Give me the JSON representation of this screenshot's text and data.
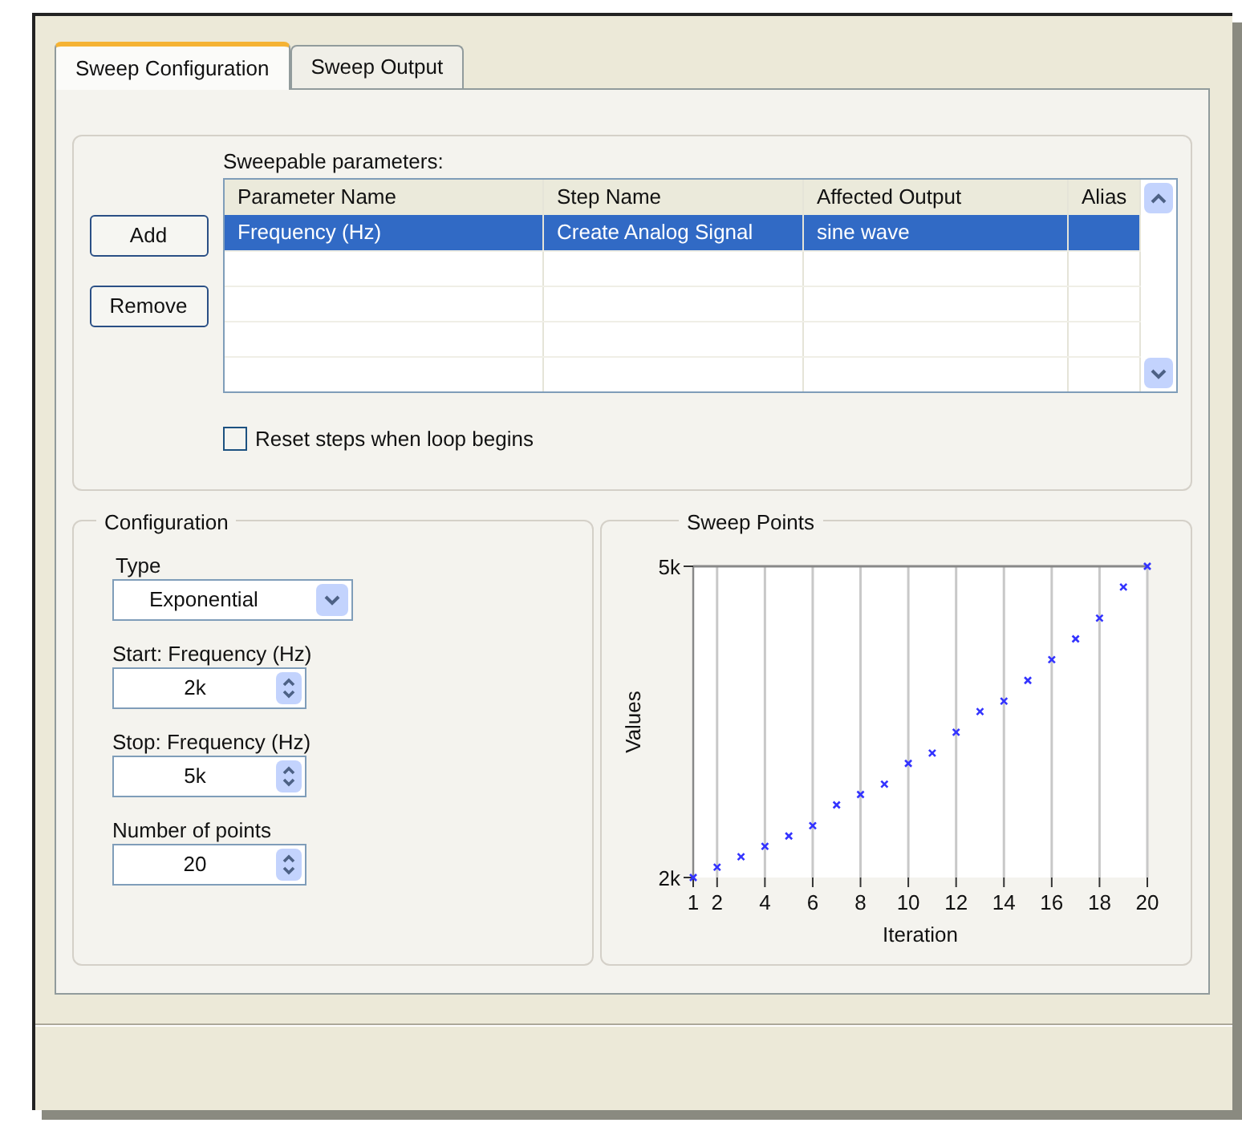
{
  "tabs": [
    {
      "label": "Sweep Configuration",
      "selected": true
    },
    {
      "label": "Sweep Output",
      "selected": false
    }
  ],
  "parameters": {
    "buttons": [
      "Add",
      "Remove"
    ],
    "label": "Sweepable parameters:",
    "table": {
      "columns": [
        "Parameter Name",
        "Step Name",
        "Affected Output",
        "Alias"
      ],
      "rows": [
        {
          "cells": [
            "Frequency (Hz)",
            "Create Analog Signal",
            "sine wave"
          ],
          "selected": true
        }
      ]
    },
    "reset_checkbox": {
      "label": "Reset steps when loop begins",
      "checked": false
    }
  },
  "configuration": {
    "title": "Configuration",
    "type": {
      "label": "Type",
      "value": "Exponential"
    },
    "fields": [
      {
        "label": "Start: Frequency (Hz)",
        "value": "2k"
      },
      {
        "label": "Stop: Frequency (Hz)",
        "value": "5k"
      },
      {
        "label": "Number of points",
        "value": "20"
      }
    ]
  },
  "sweep_points": {
    "title": "Sweep Points",
    "chart_data": {
      "type": "scatter",
      "xlabel": "Iteration",
      "ylabel": "Values",
      "x": [
        1,
        2,
        3,
        4,
        5,
        6,
        7,
        8,
        9,
        10,
        11,
        12,
        13,
        14,
        15,
        16,
        17,
        18,
        19,
        20
      ],
      "series": [
        {
          "color": "#3333ff",
          "values": [
            2000,
            2100,
            2200,
            2300,
            2400,
            2500,
            2700,
            2800,
            2900,
            3100,
            3200,
            3400,
            3600,
            3700,
            3900,
            4100,
            4300,
            4500,
            4800,
            5000
          ]
        }
      ],
      "grid": true,
      "xlim": [
        1,
        20
      ],
      "ylim": [
        2000,
        5000
      ],
      "xticks": [
        1,
        2,
        4,
        6,
        8,
        10,
        12,
        14,
        16,
        18,
        20
      ],
      "yticks": [
        {
          "value": 2000,
          "label": "2k"
        },
        {
          "value": 5000,
          "label": "5k"
        }
      ]
    }
  }
}
